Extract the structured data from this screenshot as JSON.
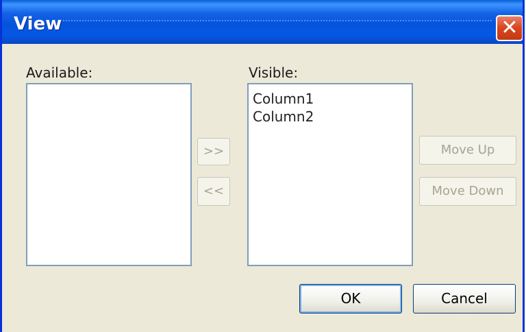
{
  "window": {
    "title": "View",
    "close_symbol": "✕"
  },
  "available": {
    "label": "Available:",
    "items": []
  },
  "visible": {
    "label": "Visible:",
    "items": [
      "Column1",
      "Column2"
    ]
  },
  "buttons": {
    "add": ">>",
    "remove": "<<",
    "move_up": "Move Up",
    "move_down": "Move Down",
    "ok": "OK",
    "cancel": "Cancel"
  }
}
